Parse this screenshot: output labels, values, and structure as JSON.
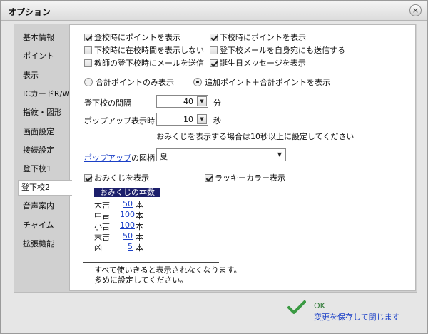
{
  "window": {
    "title": "オプション",
    "close_glyph": "×"
  },
  "sidebar": {
    "items": [
      {
        "label": "基本情報"
      },
      {
        "label": "ポイント"
      },
      {
        "label": "表示"
      },
      {
        "label": "ICカードR/W"
      },
      {
        "label": "指紋・図形"
      },
      {
        "label": "画面設定"
      },
      {
        "label": "接続設定"
      },
      {
        "label": "登下校1"
      },
      {
        "label": "登下校2",
        "active": true
      },
      {
        "label": "音声案内"
      },
      {
        "label": "チャイム"
      },
      {
        "label": "拡張機能"
      }
    ]
  },
  "checkboxes": [
    {
      "label": "登校時にポイントを表示",
      "checked": true
    },
    {
      "label": "下校時にポイントを表示",
      "checked": true
    },
    {
      "label": "下校時に在校時間を表示しない",
      "checked": false
    },
    {
      "label": "登下校メールを自身宛にも送信する",
      "checked": false
    },
    {
      "label": "教師の登下校時にメールを送信",
      "checked": false
    },
    {
      "label": "誕生日メッセージを表示",
      "checked": true
    }
  ],
  "radios": [
    {
      "label": "合計ポイントのみ表示",
      "selected": false
    },
    {
      "label": "追加ポイント＋合計ポイントを表示",
      "selected": true
    }
  ],
  "interval": {
    "label": "登下校の間隔",
    "value": "40",
    "unit": "分"
  },
  "popup_time": {
    "label": "ポップアップ表示時間",
    "value": "10",
    "unit": "秒"
  },
  "popup_note": "おみくじを表示する場合は10秒以上に設定してください",
  "popup_design": {
    "link": "ポップアップ",
    "suffix": "の図柄",
    "value": "夏"
  },
  "omikuji_toggle": {
    "label": "おみくじを表示",
    "checked": true
  },
  "lucky_color": {
    "label": "ラッキーカラー表示",
    "checked": true
  },
  "omikuji_table": {
    "header": "おみくじの本数",
    "unit": "本",
    "rows": [
      {
        "name": "大吉",
        "count": "50"
      },
      {
        "name": "中吉",
        "count": "100"
      },
      {
        "name": "小吉",
        "count": "100"
      },
      {
        "name": "末吉",
        "count": "50"
      },
      {
        "name": "凶",
        "count": "5"
      }
    ]
  },
  "note_lines": [
    "すべて使いきると表示されなくなります。",
    "多めに設定してください。"
  ],
  "ok": {
    "label": "OK",
    "sub": "変更を保存して閉じます"
  },
  "colors": {
    "accent": "#1a3fc6",
    "header_bg": "#1c1f6b",
    "ok_green": "#2f7a36"
  }
}
